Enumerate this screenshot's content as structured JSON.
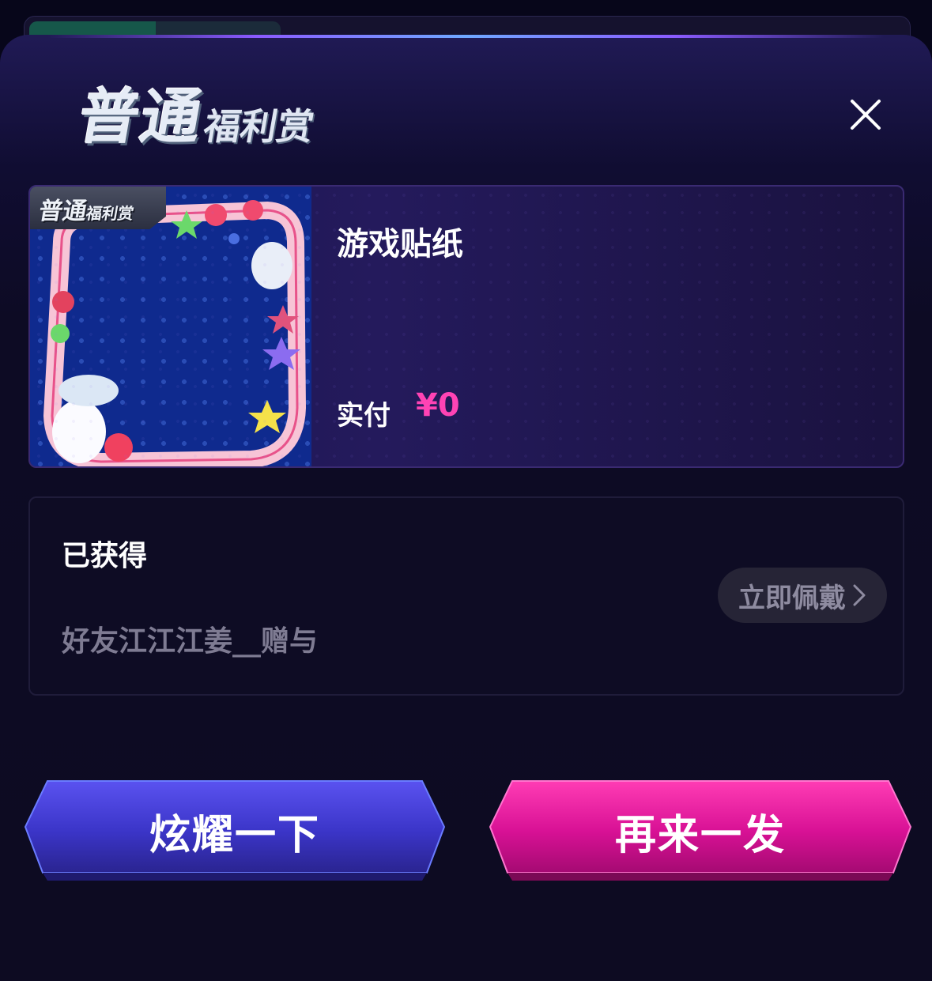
{
  "header": {
    "title_main": "普通",
    "title_sub": "福利赏",
    "close_icon": "close-icon"
  },
  "item": {
    "badge_main": "普通",
    "badge_sub": "福利赏",
    "name": "游戏贴纸",
    "paid_label": "实付",
    "paid_value": "¥0",
    "thumbnail": "sticker-frame-image",
    "price_color": "#ff43b4"
  },
  "obtained": {
    "title": "已获得",
    "description": "好友江江江姜__赠与",
    "wear_button": "立即佩戴"
  },
  "actions": {
    "show_off": "炫耀一下",
    "again": "再来一发",
    "show_off_color": "#3b35c8",
    "again_color": "#d81195"
  }
}
